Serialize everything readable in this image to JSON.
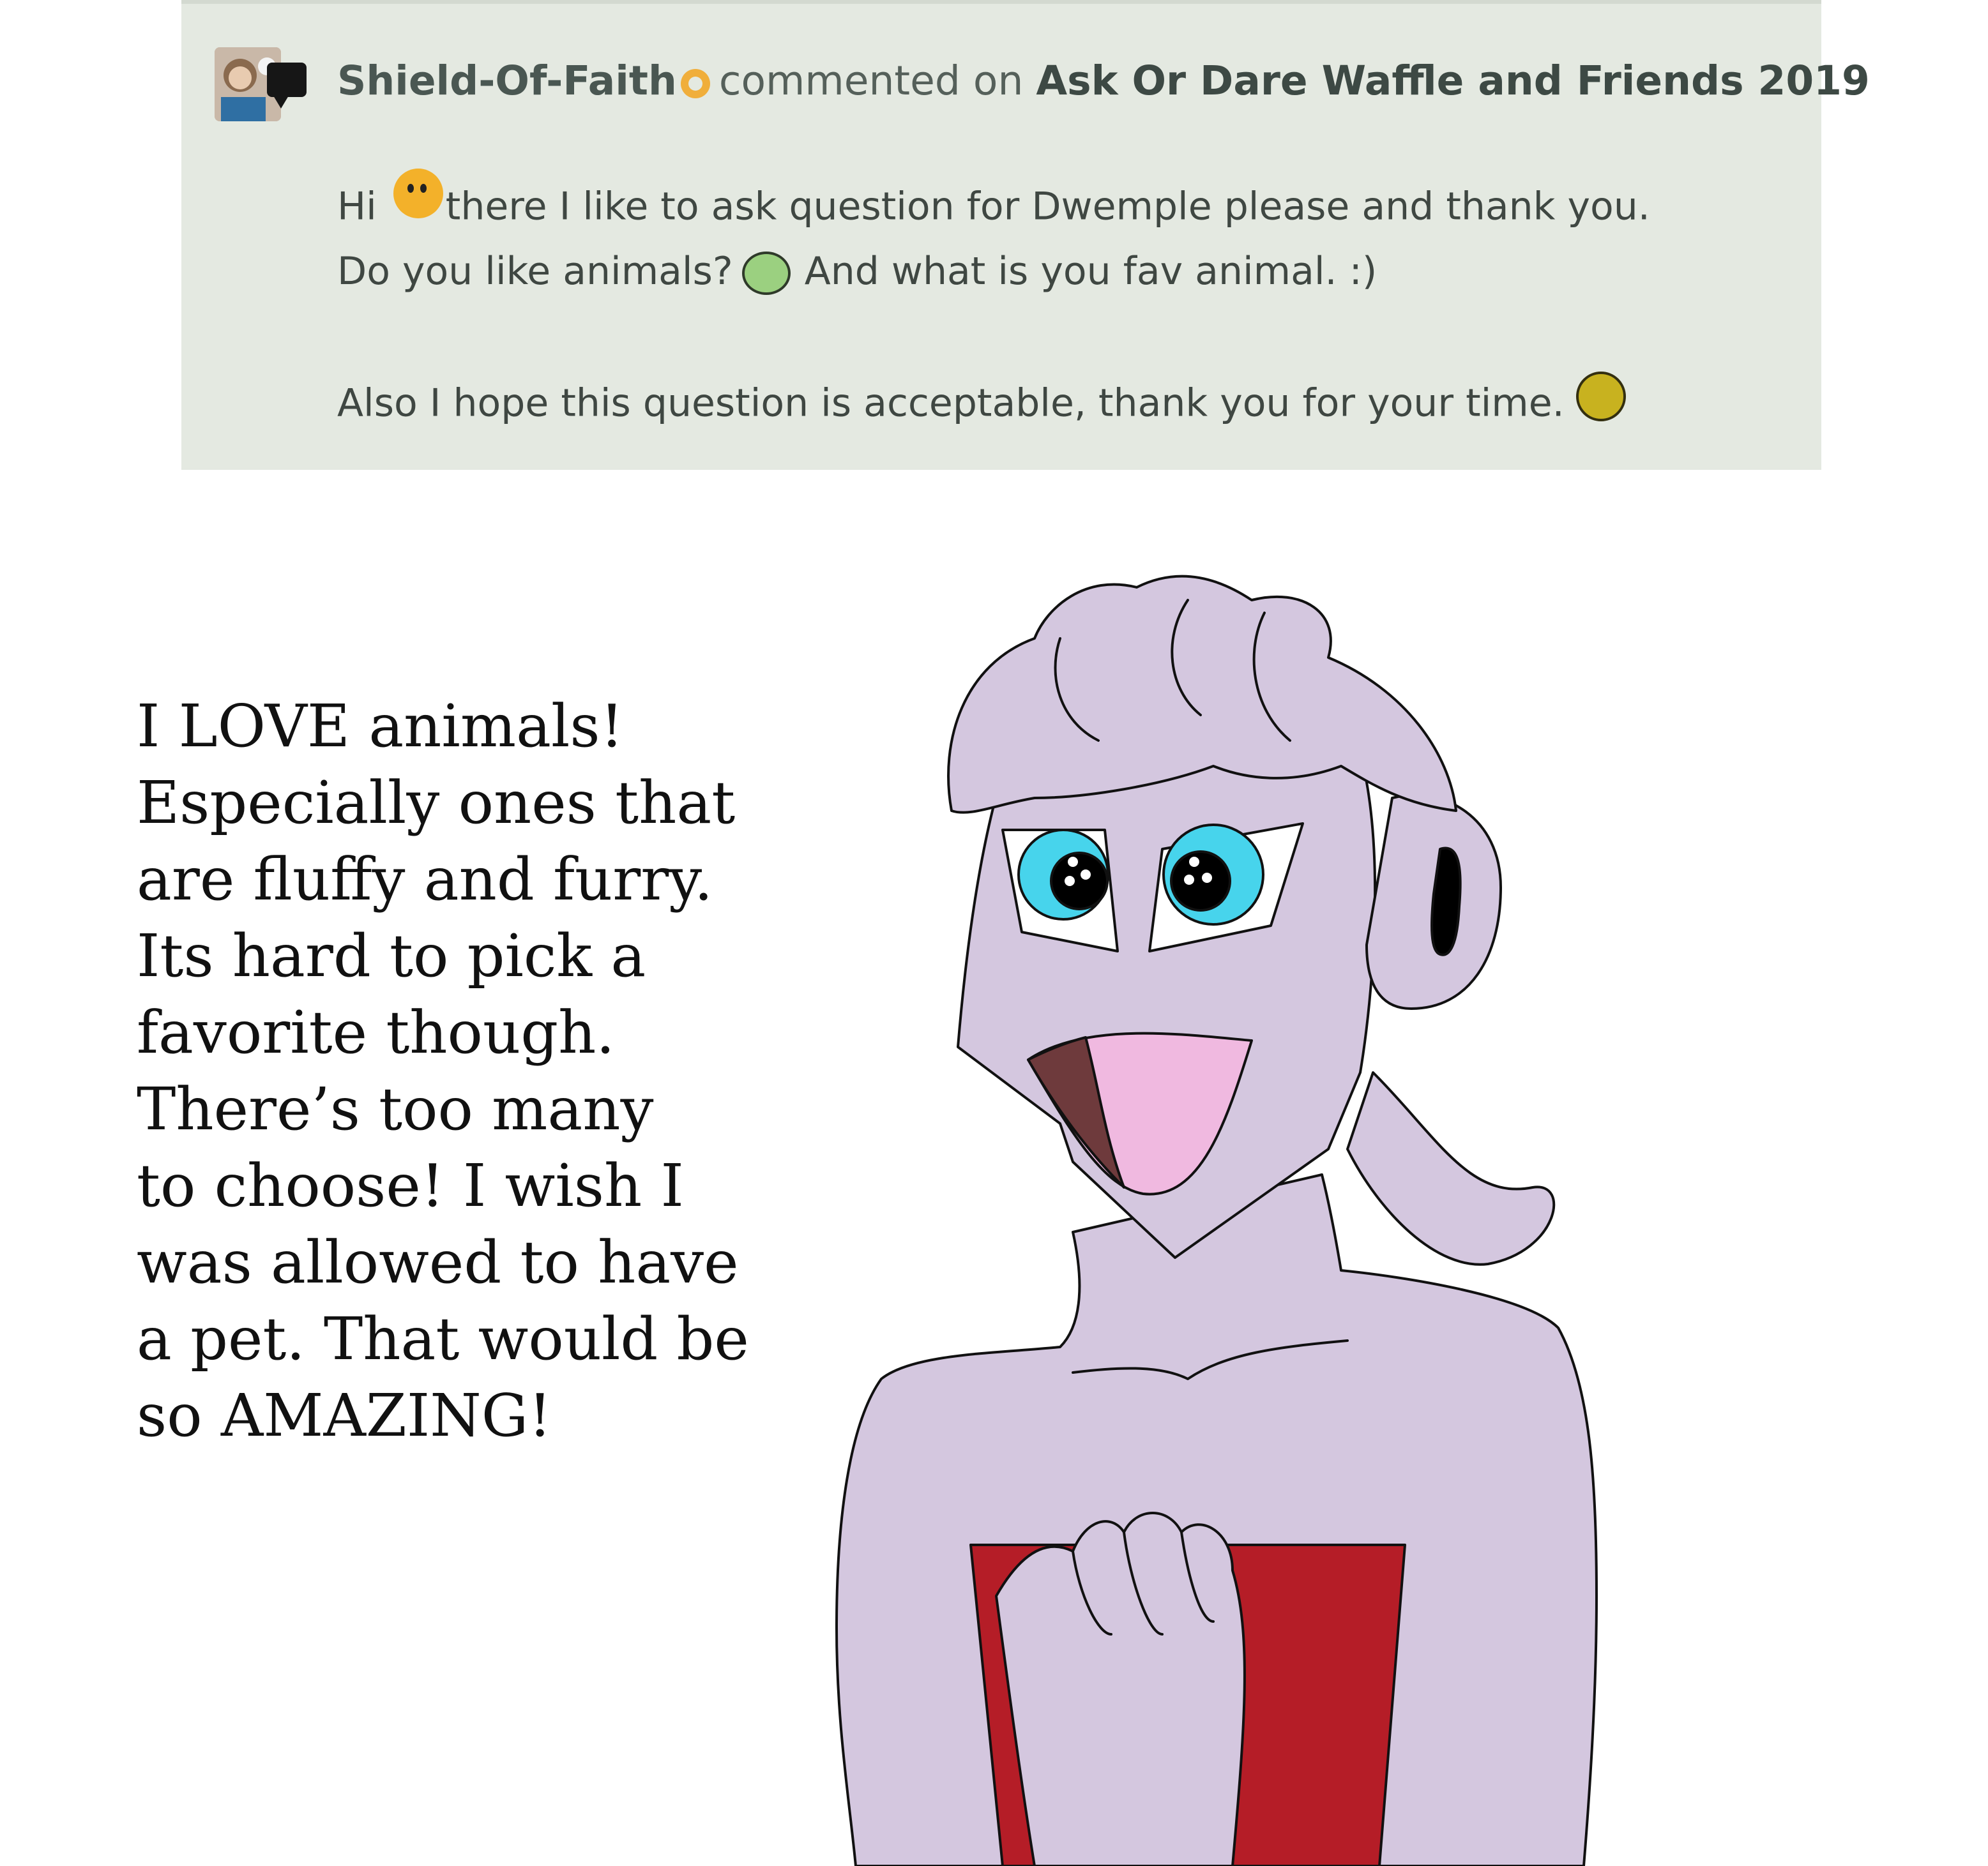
{
  "comment": {
    "username": "Shield-Of-Faith",
    "action": "commented on",
    "deviation_title": "Ask Or Dare Waffle and Friends 2019",
    "lines": [
      {
        "before": "Hi",
        "after": "there I like to ask question for Dwemple please and thank you."
      },
      {
        "before": "Do you like animals?",
        "after": "And what is you fav animal. :)"
      },
      {
        "text": "Also I hope this question is acceptable, thank you for your time."
      }
    ],
    "colors": {
      "panel": "#e4e9e1",
      "badge": "#f0ae3b"
    }
  },
  "answer_lines": [
    "I LOVE animals!",
    "Especially ones that",
    "are fluffy and furry.",
    "Its hard to pick a",
    "favorite though.",
    "There’s too many",
    "to choose! I wish I",
    "was allowed to have",
    "a pet. That would be",
    "so AMAZING!"
  ],
  "icons": {
    "avatar": "user-avatar-icon",
    "comment": "speech-bubble-icon",
    "badge": "core-member-badge-icon",
    "emoticons": [
      "waving-smiley-emoticon",
      "grinning-green-emoticon",
      "yellow-smiley-emoticon"
    ]
  }
}
